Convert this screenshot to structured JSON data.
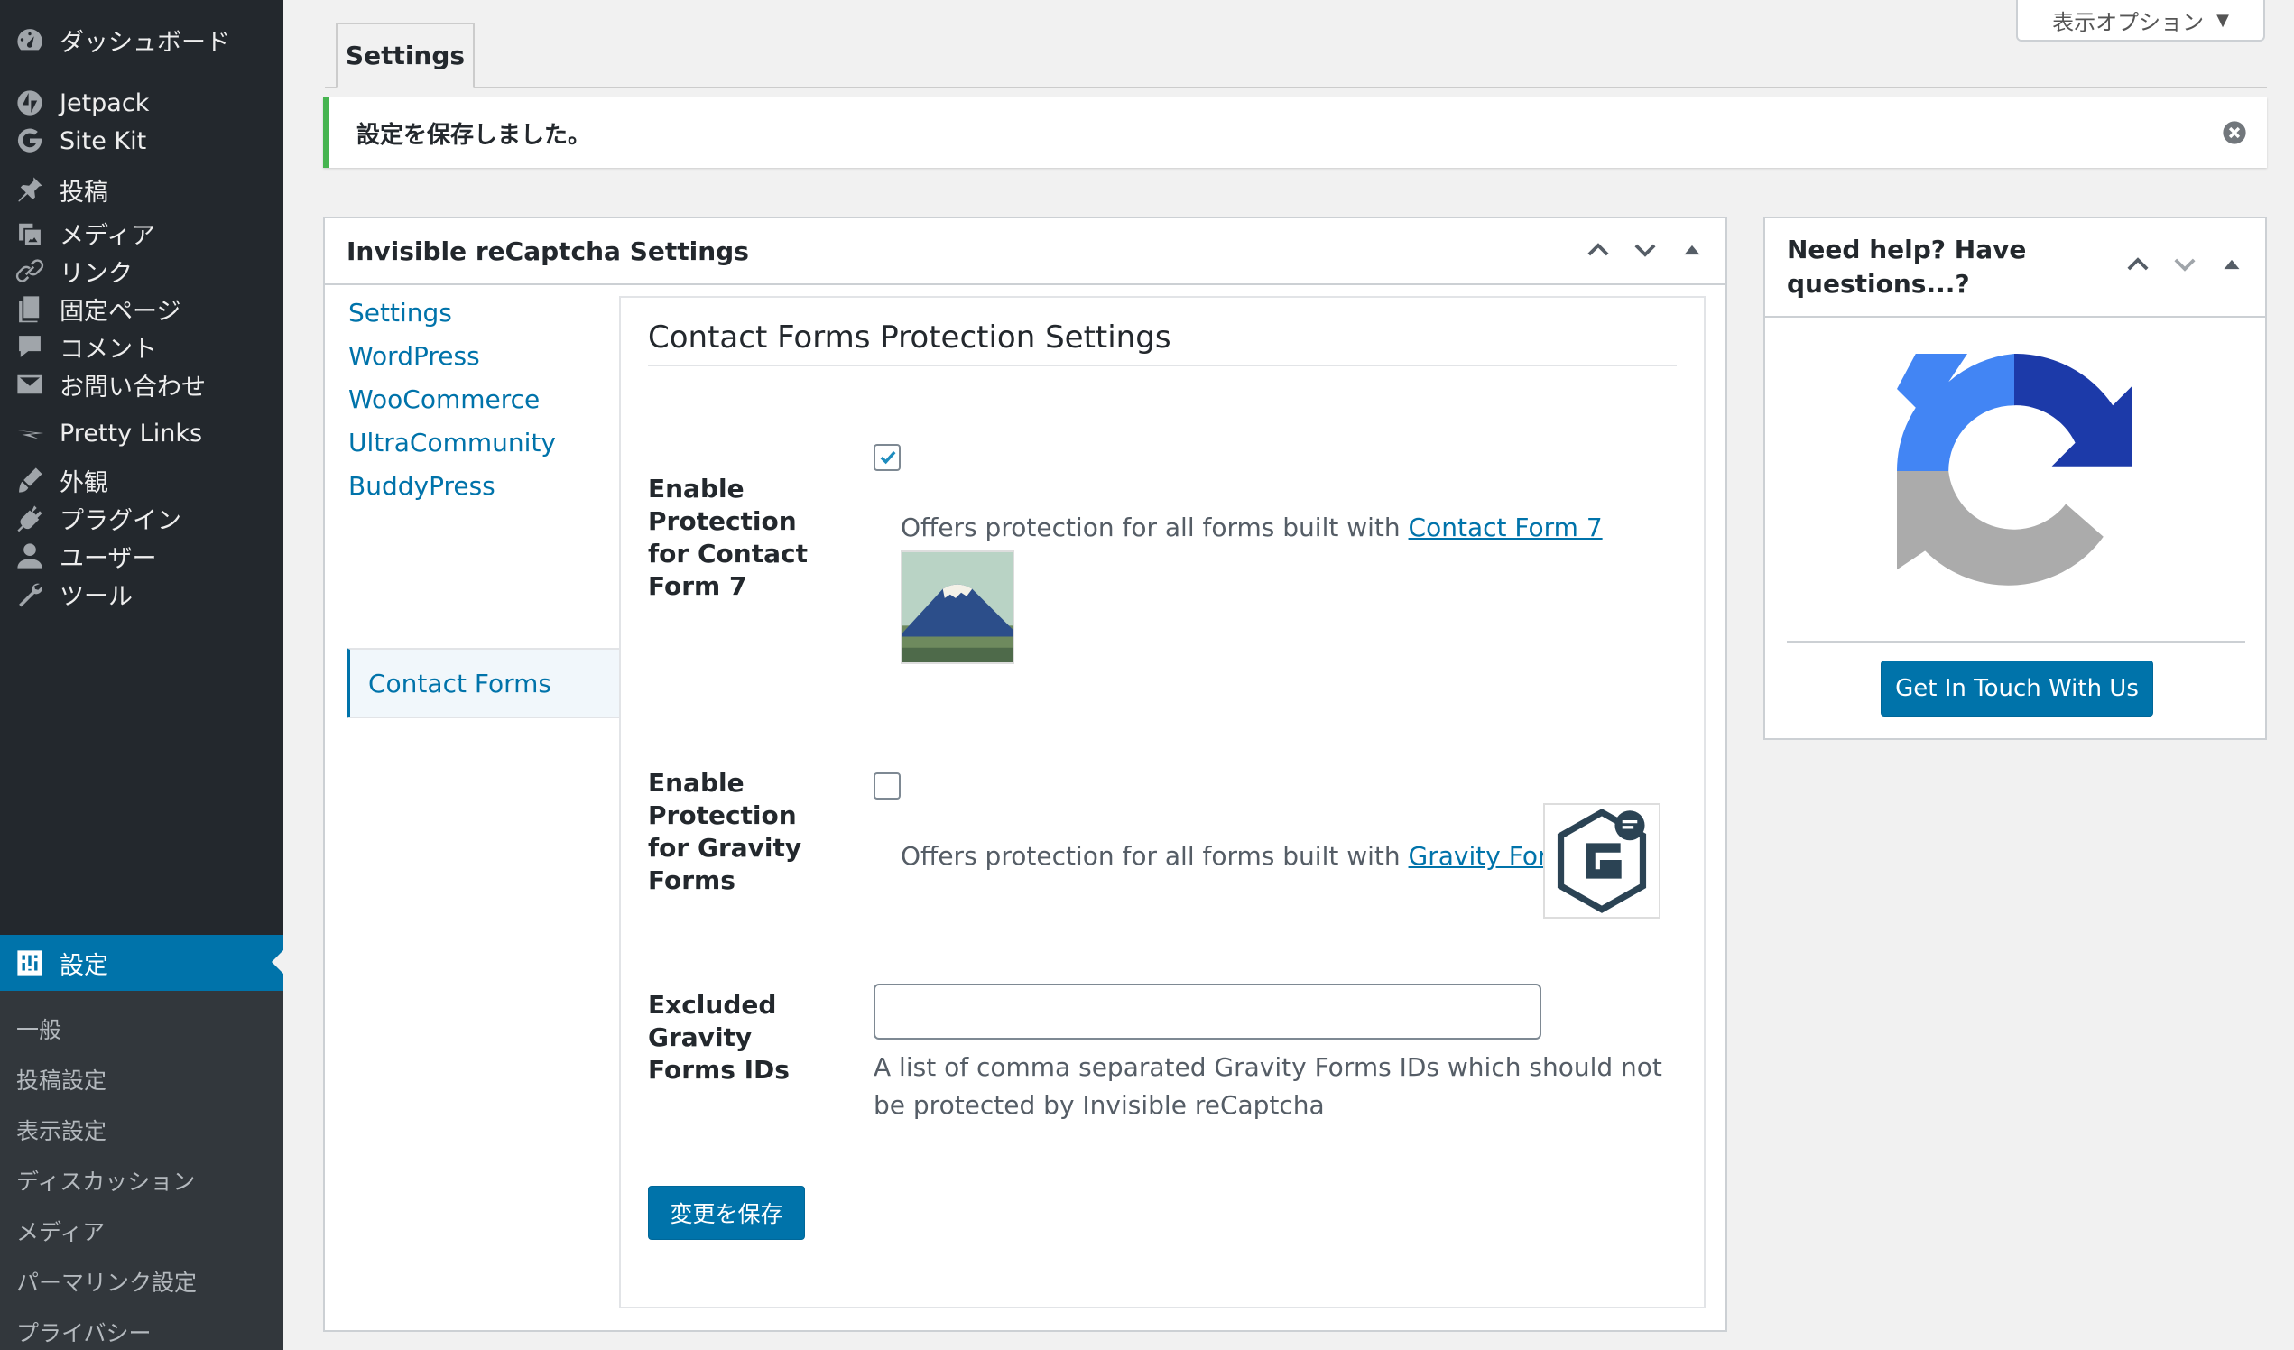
{
  "sidebar": {
    "items": [
      {
        "label": "ダッシュボード",
        "icon": "dashboard-icon"
      },
      {
        "label": "Jetpack",
        "icon": "jetpack-icon"
      },
      {
        "label": "Site Kit",
        "icon": "google-icon"
      },
      {
        "label": "投稿",
        "icon": "pin-icon"
      },
      {
        "label": "メディア",
        "icon": "media-icon"
      },
      {
        "label": "リンク",
        "icon": "link-icon"
      },
      {
        "label": "固定ページ",
        "icon": "pages-icon"
      },
      {
        "label": "コメント",
        "icon": "comment-icon"
      },
      {
        "label": "お問い合わせ",
        "icon": "mail-icon"
      },
      {
        "label": "Pretty Links",
        "icon": "pretty-links-icon"
      },
      {
        "label": "外観",
        "icon": "appearance-icon"
      },
      {
        "label": "プラグイン",
        "icon": "plugins-icon"
      },
      {
        "label": "ユーザー",
        "icon": "users-icon"
      },
      {
        "label": "ツール",
        "icon": "tools-icon"
      },
      {
        "label": "設定",
        "icon": "settings-icon"
      }
    ],
    "submenu": [
      "一般",
      "投稿設定",
      "表示設定",
      "ディスカッション",
      "メディア",
      "パーマリンク設定",
      "プライバシー"
    ]
  },
  "screen_options": "表示オプション",
  "tab": "Settings",
  "notice": "設定を保存しました。",
  "main_box": {
    "title": "Invisible reCaptcha Settings",
    "nav": [
      "Settings",
      "WordPress",
      "WooCommerce",
      "UltraCommunity",
      "BuddyPress",
      "Contact Forms"
    ],
    "panel_title": "Contact Forms Protection Settings",
    "cf7": {
      "label": "Enable Protection for Contact Form 7",
      "checked": true,
      "desc_prefix": "Offers protection for all forms built with ",
      "link": "Contact Form 7"
    },
    "gravity": {
      "label": "Enable Protection for Gravity Forms",
      "checked": false,
      "desc_prefix": "Offers protection for all forms built with ",
      "link": "Gravity Forms"
    },
    "excluded": {
      "label": "Excluded Gravity Forms IDs",
      "value": "",
      "desc": "A list of comma separated Gravity Forms IDs which should not be protected by Invisible reCaptcha"
    },
    "save_label": "変更を保存"
  },
  "help_box": {
    "title": "Need help? Have questions...?",
    "button": "Get In Touch With Us"
  },
  "colors": {
    "sidebar_bg": "#23282d",
    "accent": "#0073aa",
    "notice_success": "#46b450",
    "recaptcha_blue_light": "#4285f4",
    "recaptcha_blue_dark": "#1c3aa9",
    "recaptcha_gray": "#ababab"
  }
}
